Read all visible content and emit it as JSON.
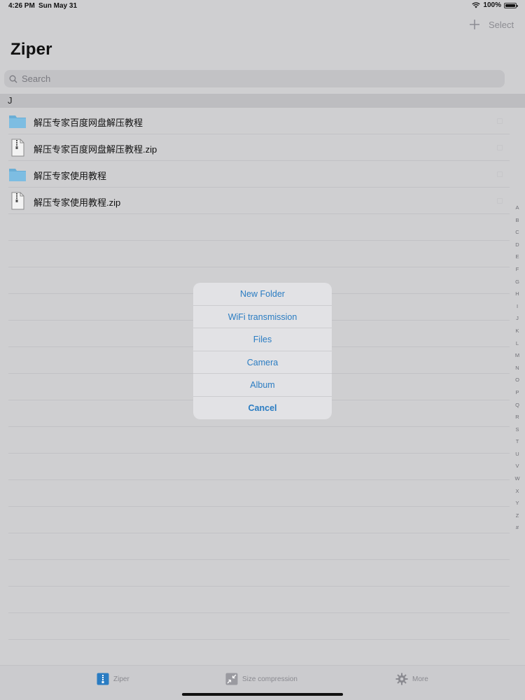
{
  "status": {
    "time": "4:26 PM",
    "date": "Sun May 31",
    "battery": "100%",
    "battery_level": 1.0
  },
  "nav": {
    "select_label": "Select",
    "title": "Ziper"
  },
  "search": {
    "placeholder": "Search"
  },
  "section": {
    "header": "J"
  },
  "files": [
    {
      "name": "解压专家百度网盘解压教程",
      "type": "folder",
      "icon": "folder-icon"
    },
    {
      "name": "解压专家百度网盘解压教程.zip",
      "type": "zip",
      "icon": "zip-file-icon"
    },
    {
      "name": "解压专家使用教程",
      "type": "folder",
      "icon": "folder-icon"
    },
    {
      "name": "解压专家使用教程.zip",
      "type": "zip",
      "icon": "zip-file-icon"
    }
  ],
  "index_letters": [
    "A",
    "B",
    "C",
    "D",
    "E",
    "F",
    "G",
    "H",
    "I",
    "J",
    "K",
    "L",
    "M",
    "N",
    "O",
    "P",
    "Q",
    "R",
    "S",
    "T",
    "U",
    "V",
    "W",
    "X",
    "Y",
    "Z",
    "#"
  ],
  "action_sheet": {
    "items": [
      "New Folder",
      "WiFi transmission",
      "Files",
      "Camera",
      "Album"
    ],
    "cancel": "Cancel"
  },
  "tabbar": {
    "items": [
      {
        "label": "Ziper",
        "icon": "zip-icon"
      },
      {
        "label": "Size compression",
        "icon": "compress-icon"
      },
      {
        "label": "More",
        "icon": "gear-icon"
      }
    ]
  },
  "colors": {
    "accent": "#2a7cc2",
    "folder": "#6aaed6",
    "background": "#cfcfd1"
  }
}
